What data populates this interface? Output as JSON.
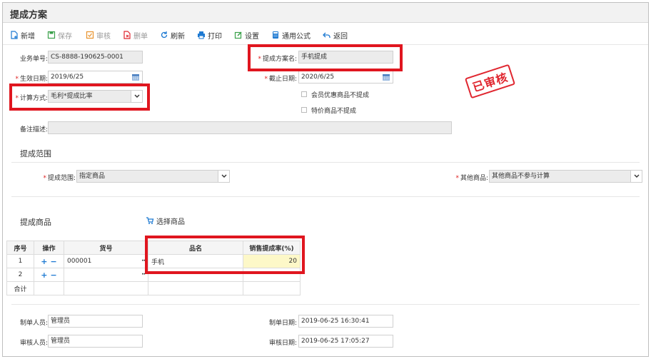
{
  "window": {
    "title": "提成方案"
  },
  "toolbar": {
    "new": "新增",
    "save": "保存",
    "audit": "审核",
    "delete": "删单",
    "refresh": "刷新",
    "print": "打印",
    "settings": "设置",
    "formula": "通用公式",
    "back": "返回"
  },
  "form": {
    "order_no_label": "业务单号:",
    "order_no": "CS-8888-190625-0001",
    "plan_name_label": "提成方案名:",
    "plan_name": "手机提成",
    "start_date_label": "生效日期:",
    "start_date": "2019/6/25",
    "end_date_label": "截止日期:",
    "end_date": "2020/6/25",
    "calc_label": "计算方式:",
    "calc_value": "毛利*提成比率",
    "check_member": "会员优惠商品不提成",
    "check_special": "特价商品不提成",
    "remark_label": "备注描述:",
    "remark": ""
  },
  "stamp": "已审核",
  "scope": {
    "title": "提成范围",
    "range_label": "提成范围:",
    "range_value": "指定商品",
    "other_label": "其他商品:",
    "other_value": "其他商品不参与计算"
  },
  "goods": {
    "title": "提成商品",
    "select_button": "选择商品",
    "headers": [
      "序号",
      "操作",
      "货号",
      "品名",
      "销售提成率(%)"
    ],
    "rows": [
      {
        "no": "1",
        "code": "000001",
        "name": "手机",
        "rate": "20"
      },
      {
        "no": "2",
        "code": "",
        "name": "",
        "rate": ""
      }
    ],
    "total_label": "合计"
  },
  "footer": {
    "maker_label": "制单人员:",
    "maker": "管理员",
    "make_date_label": "制单日期:",
    "make_date": "2019-06-25 16:30:41",
    "auditor_label": "审核人员:",
    "auditor": "管理员",
    "audit_date_label": "审核日期:",
    "audit_date": "2019-06-25 17:05:27"
  },
  "colors": {
    "highlight": "#e0161f",
    "accent": "#1e7ad2",
    "rate_cell": "#fdf8c8"
  }
}
